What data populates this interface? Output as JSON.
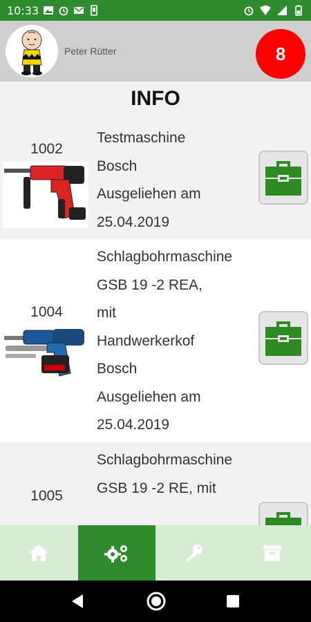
{
  "status_bar": {
    "time": "10:33",
    "left_icons": [
      "image-icon",
      "alarm-icon",
      "mail-icon",
      "phone-icon"
    ],
    "right_icons": [
      "alarm-icon",
      "wifi-icon",
      "signal-icon",
      "battery-icon"
    ]
  },
  "header": {
    "user_name": "Peter Rütter",
    "notification_count": "8",
    "badge_color": "#ff0000"
  },
  "page": {
    "title": "INFO"
  },
  "items": [
    {
      "id": "1002",
      "lines": [
        "Testmaschine",
        "Bosch",
        "Ausgeliehen am",
        "25.04.2019"
      ],
      "image": "rotary-hammer-image"
    },
    {
      "id": "1004",
      "lines": [
        "Schlagbohrmaschine",
        "GSB 19 -2 REA,",
        "mit",
        "Handwerkerkof",
        "Bosch",
        "Ausgeliehen am",
        "25.04.2019"
      ],
      "image": "impact-drill-image"
    },
    {
      "id": "1005",
      "lines": [
        "Schlagbohrmaschine",
        "GSB 19 -2 RE, mit"
      ],
      "image": "impact-drill-image"
    }
  ],
  "bottom_nav": {
    "tabs": [
      "home-icon",
      "gears-icon",
      "key-icon",
      "archive-icon"
    ],
    "active_index": 1
  },
  "colors": {
    "primary_green": "#2e8b2e",
    "light_green": "#d8ecd4",
    "toolbox_green": "#2e8b22"
  }
}
